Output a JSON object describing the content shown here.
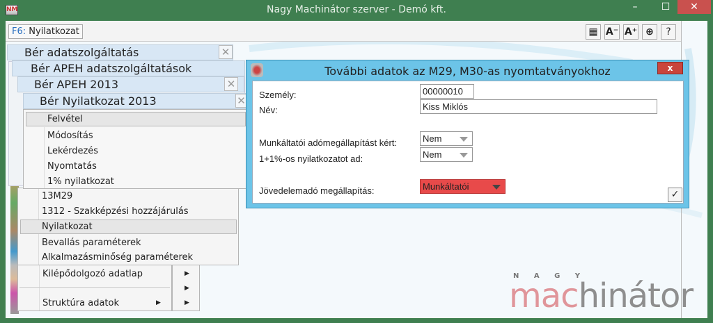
{
  "window": {
    "title": "Nagy Machinátor szerver - Demó kft.",
    "app_icon_text": "NM",
    "minimize": "–",
    "maximize": "☐",
    "close": "✕"
  },
  "toolbar": {
    "f6_key": "F6:",
    "f6_label": "Nyilatkozat",
    "buttons": [
      {
        "icon": "grid-icon",
        "label": "▦"
      },
      {
        "icon": "font-decrease-icon",
        "label": "A⁻"
      },
      {
        "icon": "font-increase-icon",
        "label": "A⁺"
      },
      {
        "icon": "lifebuoy-icon",
        "label": "⊕"
      },
      {
        "icon": "help-icon",
        "label": "?"
      }
    ]
  },
  "panels": [
    {
      "title": "Bér adatszolgáltatás"
    },
    {
      "title": "Bér APEH adatszolgáltatások"
    },
    {
      "title": "Bér APEH 2013"
    },
    {
      "title": "Bér Nyilatkozat 2013"
    }
  ],
  "close_glyph": "✕",
  "action_menu": {
    "items": [
      "Felvétel",
      "Módosítás",
      "Lekérdezés",
      "Nyomtatás",
      "1% nyilatkozat"
    ],
    "selected": "Felvétel"
  },
  "context_menu": {
    "items": [
      "13M29",
      "1312 - Szakképzési hozzájárulás",
      "Nyilatkozat",
      "Bevallás paraméterek",
      "Alkalmazásminőség paraméterek"
    ],
    "selected": "Nyilatkozat"
  },
  "lower_menu": {
    "items": [
      "Kilépődolgozó adatlap",
      "",
      "Struktúra adatok"
    ],
    "submenu_arrow": "▶"
  },
  "dialog": {
    "title": "További adatok az M29, M30-as nyomtatványokhoz",
    "close": "x",
    "fields": {
      "person_label": "Személy:",
      "person_value": "00000010",
      "name_label": "Név:",
      "name_value": "Kiss Miklós",
      "employer_tax_label": "Munkáltatói adómegállapítást kért:",
      "employer_tax_value": "Nem",
      "one_percent_label": "1+1%-os nyilatkozatot ad:",
      "one_percent_value": "Nem",
      "income_tax_label": "Jövedelemadó megállapítás:",
      "income_tax_value": "Munkáltatói"
    },
    "ok": "✓",
    "highlight_color": "#e84a4a"
  },
  "logo": {
    "top": "N A G Y",
    "left": "mac",
    "right": "hinátor"
  }
}
